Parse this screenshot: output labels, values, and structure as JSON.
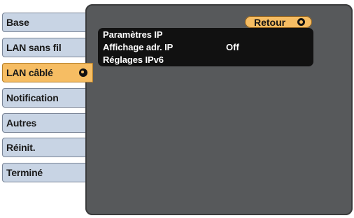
{
  "sidebar": {
    "items": [
      {
        "label": "Base"
      },
      {
        "label": "LAN sans fil"
      },
      {
        "label": "LAN câblé"
      },
      {
        "label": "Notification"
      },
      {
        "label": "Autres"
      },
      {
        "label": "Réinit."
      },
      {
        "label": "Terminé"
      }
    ],
    "selected_index": 2,
    "selected_icon": "circle-arrow-icon"
  },
  "main": {
    "back_button": {
      "label": "Retour",
      "icon": "circle-arrow-icon"
    },
    "items": [
      {
        "label": "Paramètres IP",
        "value": ""
      },
      {
        "label": "Affichage adr. IP",
        "value": "Off"
      },
      {
        "label": "Réglages IPv6",
        "value": ""
      }
    ]
  },
  "colors": {
    "menu_bg": "#c8d4e4",
    "selected_bg": "#f6bd63",
    "panel_bg": "#57595b",
    "submenu_bg": "#111111"
  }
}
